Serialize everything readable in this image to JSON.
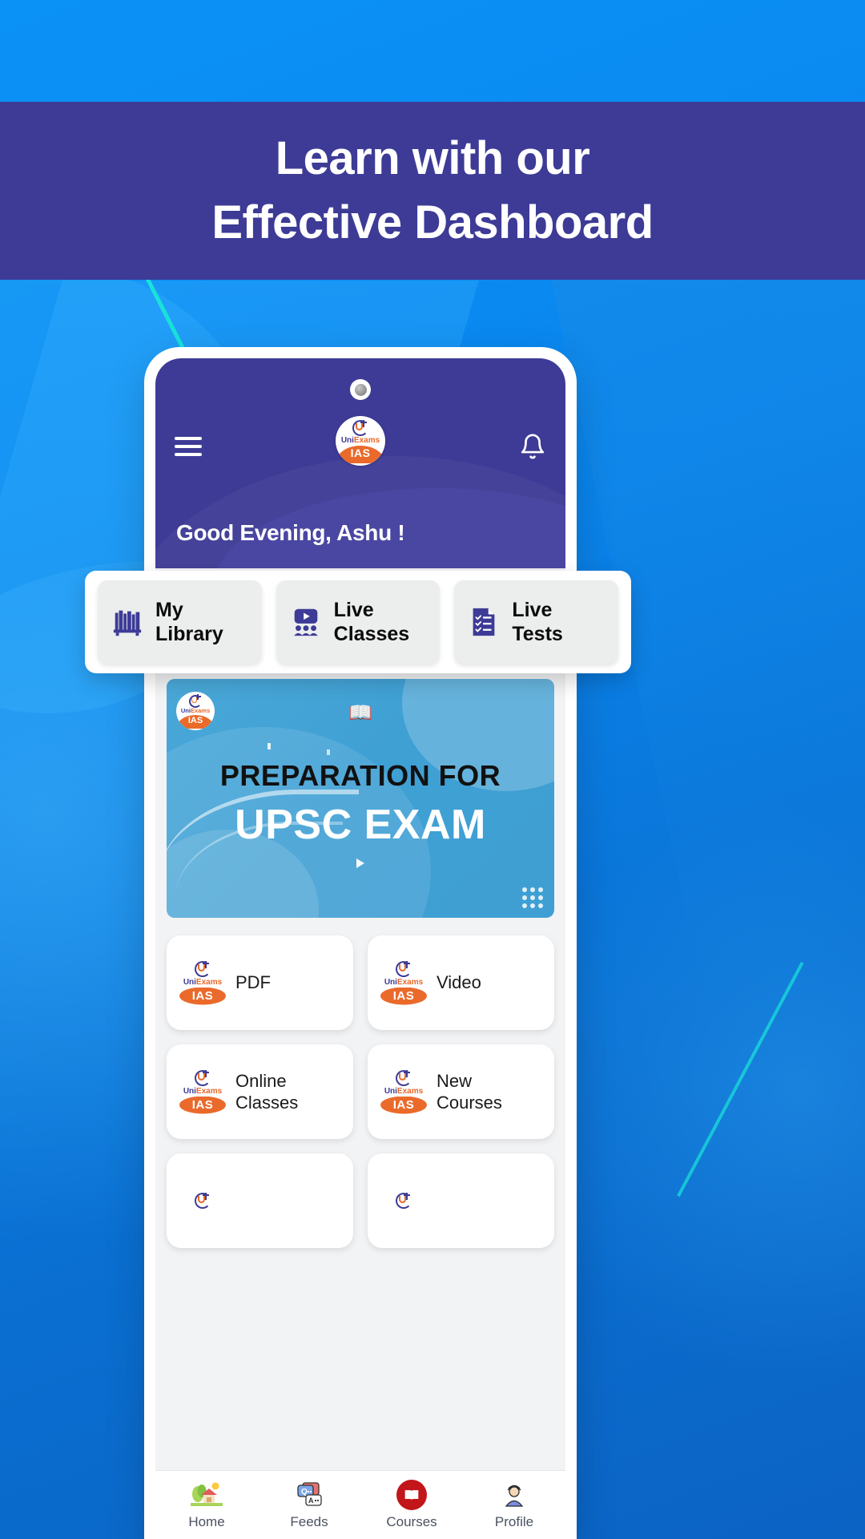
{
  "headline": {
    "line1": "Learn with our",
    "line2": "Effective Dashboard",
    "bg_color": "#3d3b96",
    "text_color": "#ffffff"
  },
  "phone": {
    "app_header": {
      "menu_icon": "hamburger-icon",
      "notification_icon": "bell-icon",
      "logo": {
        "name_prefix": "Uni",
        "name_suffix": "Exams",
        "sub": "IAS",
        "accent": "#ea6a2b",
        "brand": "#3d3b96"
      },
      "greeting": "Good Evening, Ashu !"
    },
    "quick_actions": [
      {
        "label_line1": "My",
        "label_line2": "Library",
        "icon": "bookshelf-icon"
      },
      {
        "label_line1": "Live",
        "label_line2": "Classes",
        "icon": "live-class-icon"
      },
      {
        "label_line1": "Live",
        "label_line2": "Tests",
        "icon": "checklist-document-icon"
      }
    ],
    "banner": {
      "title_top": "PREPARATION FOR",
      "title_main": "UPSC EXAM",
      "book_glyph": "📖",
      "bg_color": "#3f9fd3"
    },
    "cards": [
      {
        "label_line1": "PDF",
        "label_line2": ""
      },
      {
        "label_line1": "Video",
        "label_line2": ""
      },
      {
        "label_line1": "Online",
        "label_line2": "Classes"
      },
      {
        "label_line1": "New",
        "label_line2": "Courses"
      }
    ],
    "bottom_nav": [
      {
        "label": "Home",
        "icon": "house-icon",
        "glyph": "🏡"
      },
      {
        "label": "Feeds",
        "icon": "qa-chat-icon",
        "glyph": "💬"
      },
      {
        "label": "Courses",
        "icon": "book-icon",
        "glyph": ""
      },
      {
        "label": "Profile",
        "icon": "person-icon",
        "glyph": "👤"
      }
    ]
  }
}
